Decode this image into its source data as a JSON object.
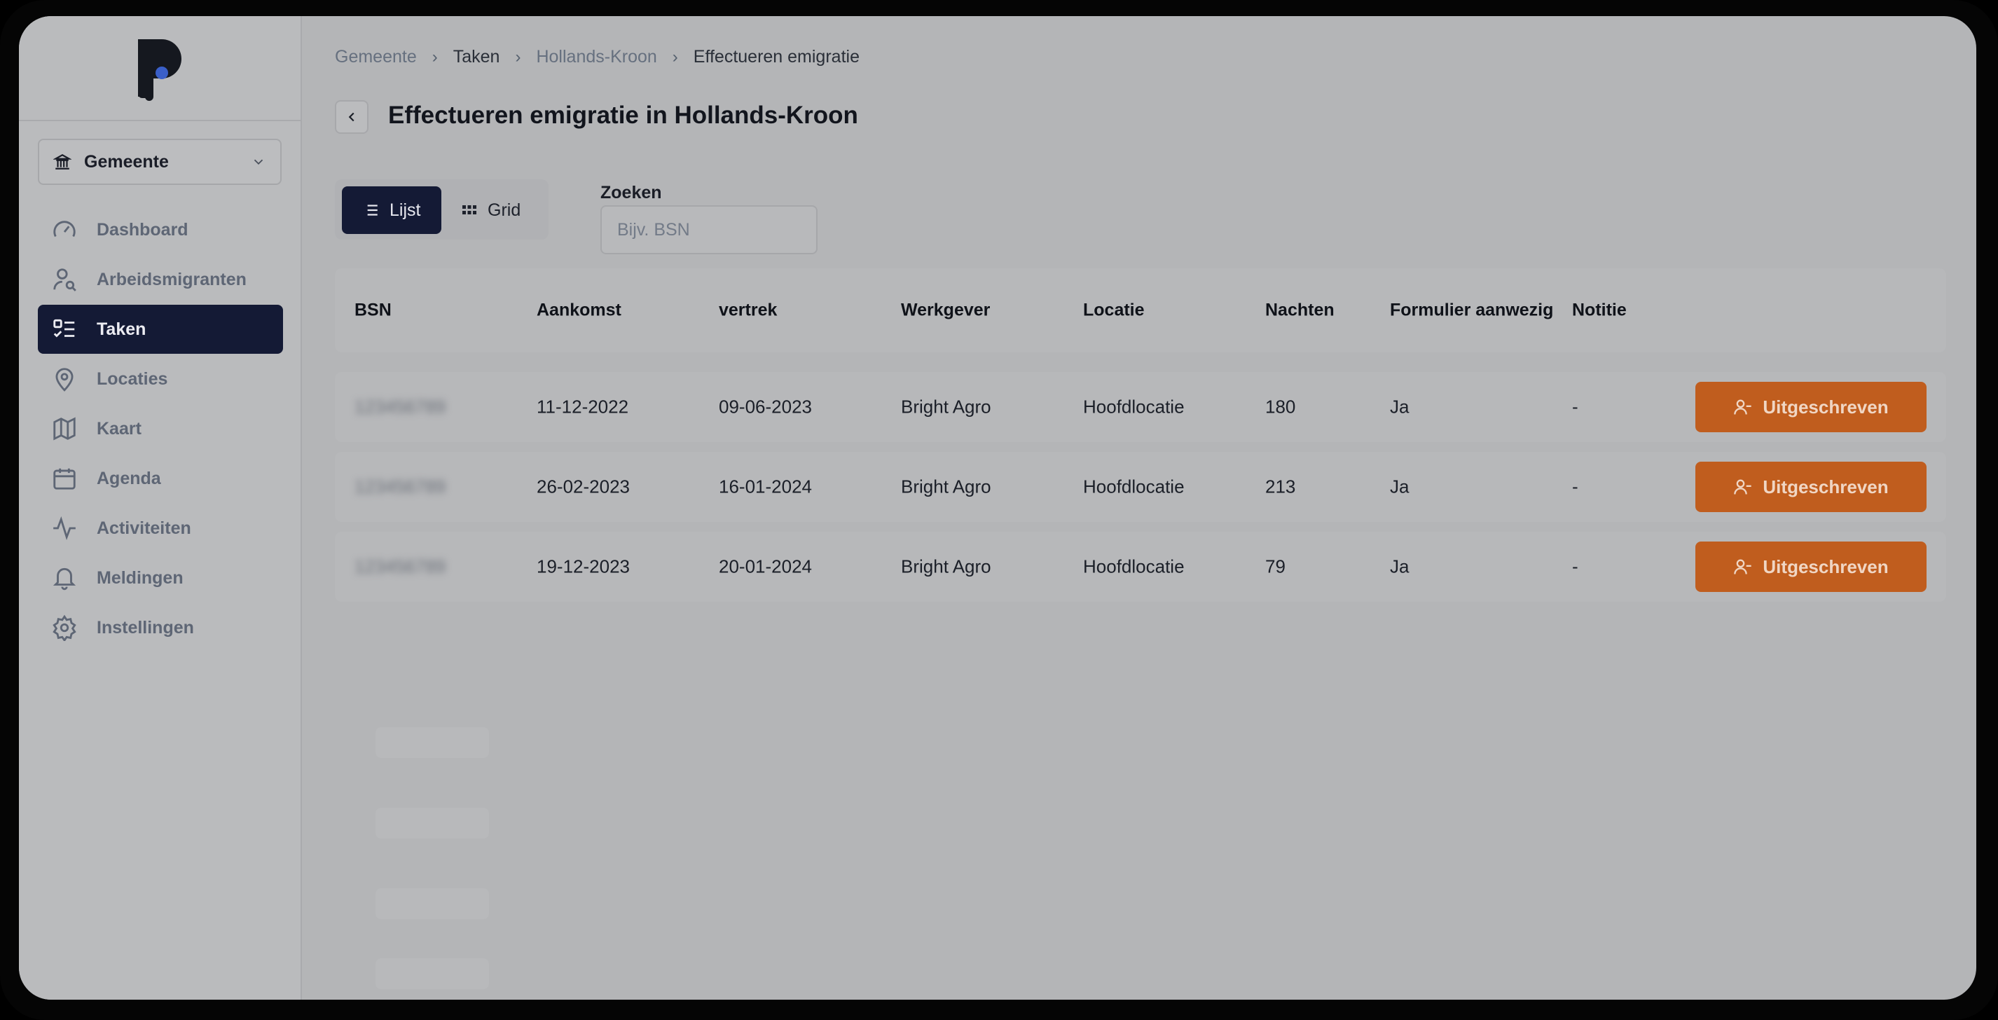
{
  "sidebar": {
    "org_select": "Gemeente",
    "items": [
      {
        "label": "Dashboard",
        "icon": "gauge-icon"
      },
      {
        "label": "Arbeidsmigranten",
        "icon": "user-search-icon"
      },
      {
        "label": "Taken",
        "icon": "checklist-icon",
        "active": true
      },
      {
        "label": "Locaties",
        "icon": "map-pin-icon"
      },
      {
        "label": "Kaart",
        "icon": "map-icon"
      },
      {
        "label": "Agenda",
        "icon": "calendar-icon"
      },
      {
        "label": "Activiteiten",
        "icon": "activity-icon"
      },
      {
        "label": "Meldingen",
        "icon": "bell-icon"
      },
      {
        "label": "Instellingen",
        "icon": "gear-icon"
      }
    ]
  },
  "breadcrumb": [
    "Gemeente",
    "Taken",
    "Hollands-Kroon",
    "Effectueren emigratie"
  ],
  "page_title": "Effectueren emigratie in Hollands-Kroon",
  "view_toggle": {
    "list": "Lijst",
    "grid": "Grid"
  },
  "search": {
    "label": "Zoeken",
    "placeholder": "Bijv. BSN"
  },
  "table": {
    "headers": [
      "BSN",
      "Aankomst",
      "vertrek",
      "Werkgever",
      "Locatie",
      "Nachten",
      "Formulier aanwezig",
      "Notitie"
    ],
    "rows": [
      {
        "bsn": "123456789",
        "aankomst": "11-12-2022",
        "vertrek": "09-06-2023",
        "werkgever": "Bright Agro",
        "locatie": "Hoofdlocatie",
        "nachten": "180",
        "formulier": "Ja",
        "notitie": "-",
        "action": "Uitgeschreven"
      },
      {
        "bsn": "123456789",
        "aankomst": "26-02-2023",
        "vertrek": "16-01-2024",
        "werkgever": "Bright Agro",
        "locatie": "Hoofdlocatie",
        "nachten": "213",
        "formulier": "Ja",
        "notitie": "-",
        "action": "Uitgeschreven"
      },
      {
        "bsn": "123456789",
        "aankomst": "19-12-2023",
        "vertrek": "20-01-2024",
        "werkgever": "Bright Agro",
        "locatie": "Hoofdlocatie",
        "nachten": "79",
        "formulier": "Ja",
        "notitie": "-",
        "action": "Uitgeschreven"
      }
    ]
  },
  "colors": {
    "accent": "#141a35",
    "action": "#c05d1e",
    "logo_dot": "#3a5fc8"
  }
}
